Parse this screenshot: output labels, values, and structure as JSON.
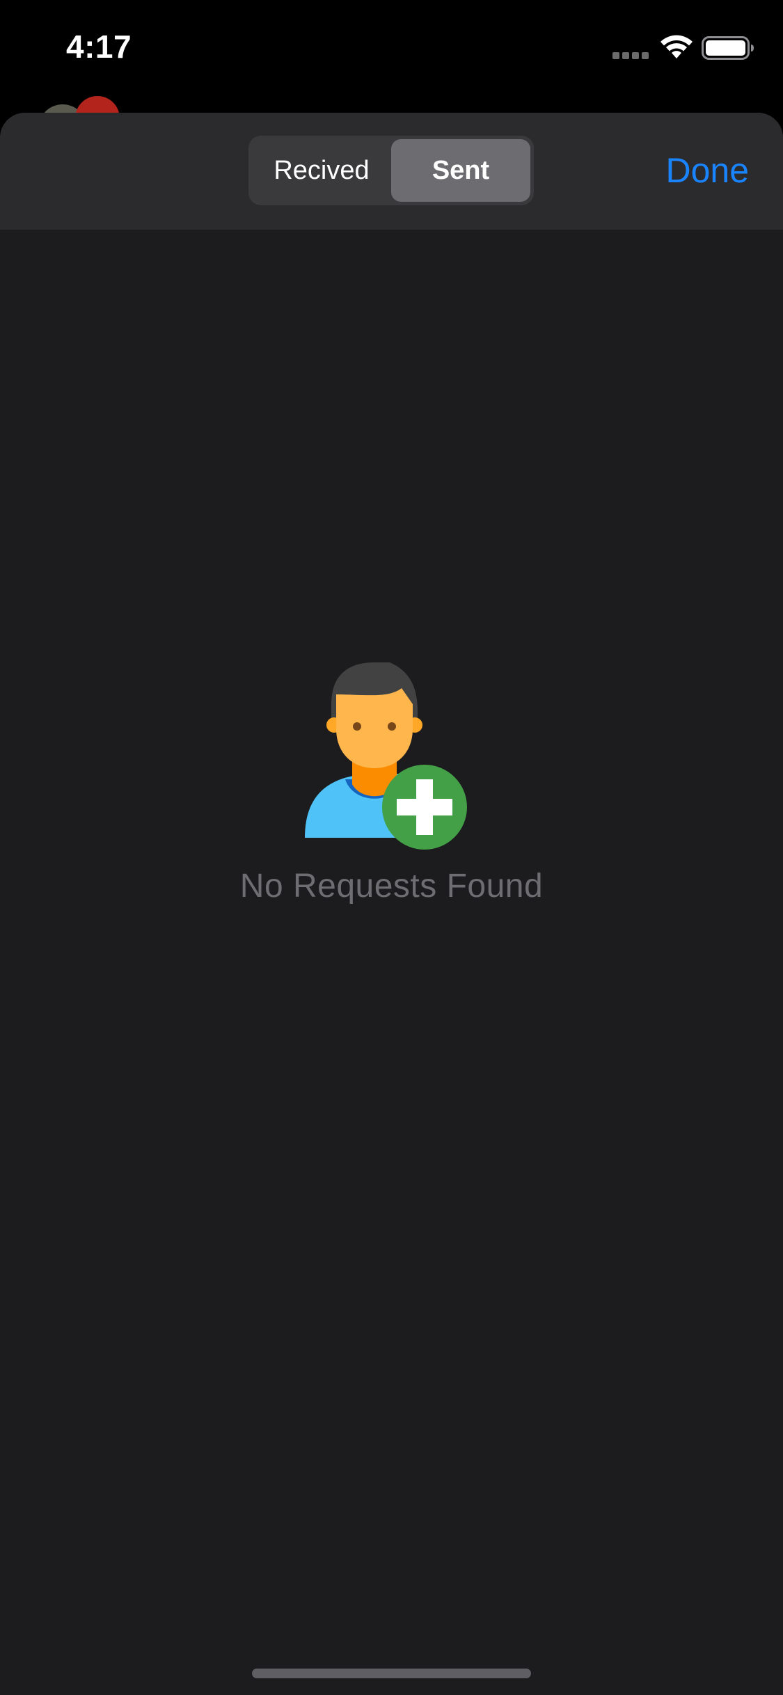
{
  "status_bar": {
    "time": "4:17"
  },
  "tabs": [
    {
      "label": "Recived",
      "selected": false
    },
    {
      "label": "Sent",
      "selected": true
    }
  ],
  "nav": {
    "done_label": "Done"
  },
  "empty_state": {
    "icon": "add-user-icon",
    "message": "No Requests Found"
  },
  "colors": {
    "accent": "#1a84ff",
    "sheet_background": "#1c1c1e",
    "nav_background": "#2b2b2d",
    "segment_selected": "#6d6d71",
    "add_badge": "#43a047"
  }
}
